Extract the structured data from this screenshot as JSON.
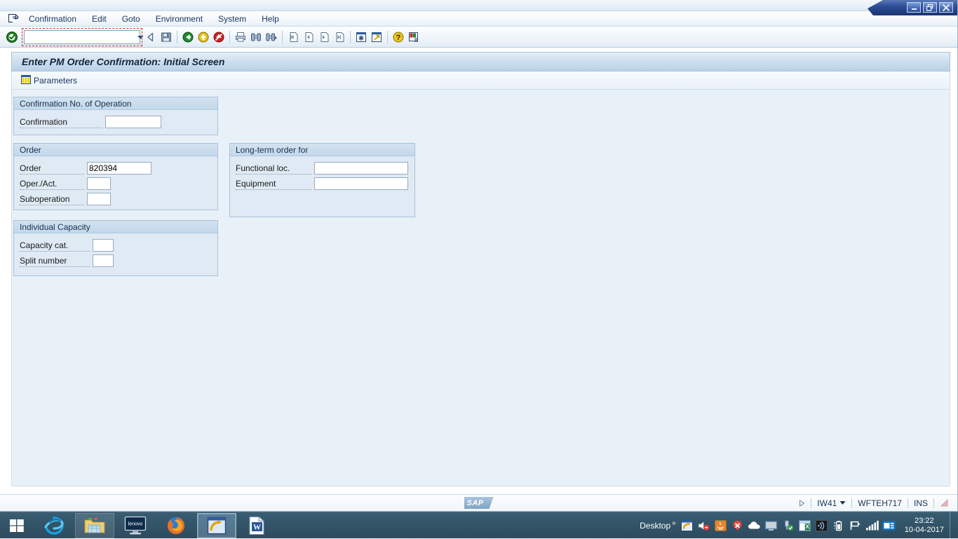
{
  "window": {
    "controls": [
      {
        "name": "minimize",
        "glyph": "minimize-icon"
      },
      {
        "name": "restore",
        "glyph": "restore-icon"
      },
      {
        "name": "close",
        "glyph": "close-icon"
      }
    ]
  },
  "menubar": {
    "system_icon": "sap-system-menu-icon",
    "items": [
      {
        "label": "Confirmation",
        "accel": "fi"
      },
      {
        "label": "Edit",
        "accel": "E"
      },
      {
        "label": "Goto",
        "accel": "G"
      },
      {
        "label": "Environment",
        "accel": "v"
      },
      {
        "label": "System",
        "accel": "y"
      },
      {
        "label": "Help",
        "accel": "H"
      }
    ]
  },
  "toolbar": {
    "enter_icon": "green-check-enter-icon",
    "command_field": {
      "value": "",
      "placeholder": "",
      "dropdown_icon": "chevron-down-icon"
    },
    "buttons": [
      {
        "name": "back-left-arrow",
        "icon": "left-triangle-icon"
      },
      {
        "name": "save",
        "icon": "save-disk-icon"
      },
      {
        "name": "back",
        "icon": "green-back-arrow-icon"
      },
      {
        "name": "exit",
        "icon": "yellow-exit-arrow-icon"
      },
      {
        "name": "cancel",
        "icon": "red-cancel-icon"
      },
      {
        "name": "print",
        "icon": "printer-icon"
      },
      {
        "name": "find",
        "icon": "binoculars-find-icon"
      },
      {
        "name": "find-next",
        "icon": "binoculars-find-next-icon"
      },
      {
        "name": "first-page",
        "icon": "first-page-icon"
      },
      {
        "name": "previous-page",
        "icon": "previous-page-icon"
      },
      {
        "name": "next-page",
        "icon": "next-page-icon"
      },
      {
        "name": "last-page",
        "icon": "last-page-icon"
      },
      {
        "name": "create-session",
        "icon": "new-session-icon"
      },
      {
        "name": "create-shortcut",
        "icon": "shortcut-arrow-icon"
      },
      {
        "name": "help",
        "icon": "question-help-icon"
      },
      {
        "name": "customize-local-layout",
        "icon": "layout-customize-icon"
      }
    ]
  },
  "screen": {
    "title": "Enter PM Order Confirmation: Initial Screen",
    "app_toolbar": {
      "parameters_label": "Parameters",
      "parameters_icon": "table-columns-icon"
    }
  },
  "groups": {
    "confirmation": {
      "title": "Confirmation No. of Operation",
      "fields": [
        {
          "label": "Confirmation",
          "value": "",
          "width": 80,
          "label_width": 118
        }
      ]
    },
    "order": {
      "title": "Order",
      "fields": [
        {
          "label": "Order",
          "value": "820394",
          "width": 92,
          "label_width": 92
        },
        {
          "label": "Oper./Act.",
          "value": "",
          "width": 34,
          "label_width": 92
        },
        {
          "label": "Suboperation",
          "value": "",
          "width": 34,
          "label_width": 92
        }
      ]
    },
    "longterm": {
      "title": "Long-term order for",
      "fields": [
        {
          "label": "Functional loc.",
          "value": "",
          "width": 134,
          "label_width": 108
        },
        {
          "label": "Equipment",
          "value": "",
          "width": 134,
          "label_width": 108
        }
      ]
    },
    "capacity": {
      "title": "Individual Capacity",
      "fields": [
        {
          "label": "Capacity cat.",
          "value": "",
          "width": 30,
          "label_width": 100
        },
        {
          "label": "Split number",
          "value": "",
          "width": 30,
          "label_width": 100
        }
      ]
    }
  },
  "statusbar": {
    "logo": "SAP",
    "expand_icon": "right-triangle-icon",
    "transaction": "IW41",
    "transaction_dropdown_icon": "chevron-down-icon",
    "system": "WFTEH717",
    "insert_mode": "INS",
    "resize_grip_icon": "resize-grip-icon"
  },
  "taskbar": {
    "start_icon": "windows-start-icon",
    "apps": [
      {
        "name": "internet-explorer",
        "icon": "internet-explorer-icon",
        "state": "pinned"
      },
      {
        "name": "file-explorer",
        "icon": "folder-explorer-icon",
        "state": "pinned"
      },
      {
        "name": "lenovo-settings",
        "icon": "lenovo-monitor-icon",
        "state": "running"
      },
      {
        "name": "firefox",
        "icon": "firefox-icon",
        "state": "running"
      },
      {
        "name": "sap-logon",
        "icon": "sap-logon-icon",
        "state": "active"
      },
      {
        "name": "microsoft-word",
        "icon": "word-icon",
        "state": "running"
      }
    ],
    "show_desktop_label": "Desktop",
    "show_desktop_chevron": "»",
    "tray": [
      {
        "name": "sap-gui-tray",
        "icon": "sap-tray-icon"
      },
      {
        "name": "volume-muted",
        "icon": "speaker-muted-icon"
      },
      {
        "name": "java-updater",
        "icon": "java-icon"
      },
      {
        "name": "antivirus",
        "icon": "antivirus-x-icon"
      },
      {
        "name": "onedrive",
        "icon": "cloud-icon"
      },
      {
        "name": "display-settings",
        "icon": "monitor-icon"
      },
      {
        "name": "safely-remove-hardware",
        "icon": "usb-check-icon"
      },
      {
        "name": "excel-tray",
        "icon": "excel-tray-icon"
      },
      {
        "name": "wireless-display",
        "icon": "wireless-icon"
      },
      {
        "name": "battery",
        "icon": "battery-icon"
      },
      {
        "name": "flag-action-center",
        "icon": "flag-icon"
      },
      {
        "name": "network-signal",
        "icon": "signal-bars-icon"
      },
      {
        "name": "lenovo-tray",
        "icon": "lenovo-tray-icon"
      }
    ],
    "clock": {
      "time": "23:22",
      "date": "10-04-2017"
    }
  }
}
